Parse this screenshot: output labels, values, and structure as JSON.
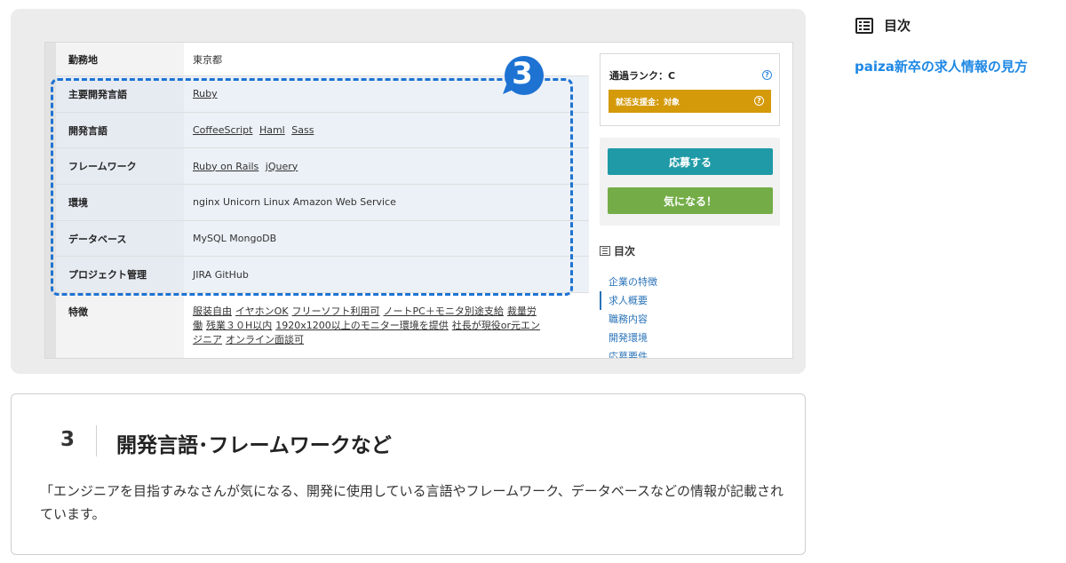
{
  "screenshot": {
    "rows": [
      {
        "label": "勤務地",
        "value": "東京都",
        "links": []
      },
      {
        "label": "主要開発言語",
        "value": "",
        "links": [
          "Ruby"
        ]
      },
      {
        "label": "開発言語",
        "value": "",
        "links": [
          "CoffeeScript",
          "Haml",
          "Sass"
        ]
      },
      {
        "label": "フレームワーク",
        "value": "",
        "links": [
          "Ruby on Rails",
          "jQuery"
        ]
      },
      {
        "label": "環境",
        "value": "nginx Unicorn Linux Amazon Web Service",
        "links": []
      },
      {
        "label": "データベース",
        "value": "MySQL MongoDB",
        "links": []
      },
      {
        "label": "プロジェクト管理",
        "value": "JIRA GitHub",
        "links": []
      }
    ],
    "features_label": "特徴",
    "features": [
      "服装自由",
      "イヤホンOK",
      "フリーソフト利用可",
      "ノートPC＋モニタ別途支給",
      "裁量労働",
      "残業３０H以内",
      "1920x1200以上のモニター環境を提供",
      "社長が現役or元エンジニア",
      "オンライン面談可"
    ],
    "callout_number": "3",
    "rank_label": "通過ランク：C",
    "support_label": "就活支援金：対象",
    "apply_button": "応募する",
    "favorite_button": "気になる！",
    "toc_title": "目次",
    "toc_items": [
      "企業の特徴",
      "求人概要",
      "職務内容",
      "開発環境",
      "応募要件"
    ],
    "toc_active_index": 1,
    "highlight_color": "#1e73d2",
    "apply_color": "#1f9aa6",
    "favorite_color": "#74ad47",
    "support_color": "#d49a0a"
  },
  "card": {
    "number": "3",
    "title": "開発言語･フレームワークなど",
    "body": "「エンジニアを目指すみなさんが気になる、開発に使用している言語やフレームワーク、データベースなどの情報が記載されています。"
  },
  "sidebar": {
    "title": "目次",
    "link": "paiza新卒の求人情報の見方",
    "link_color": "#1e88e5"
  }
}
